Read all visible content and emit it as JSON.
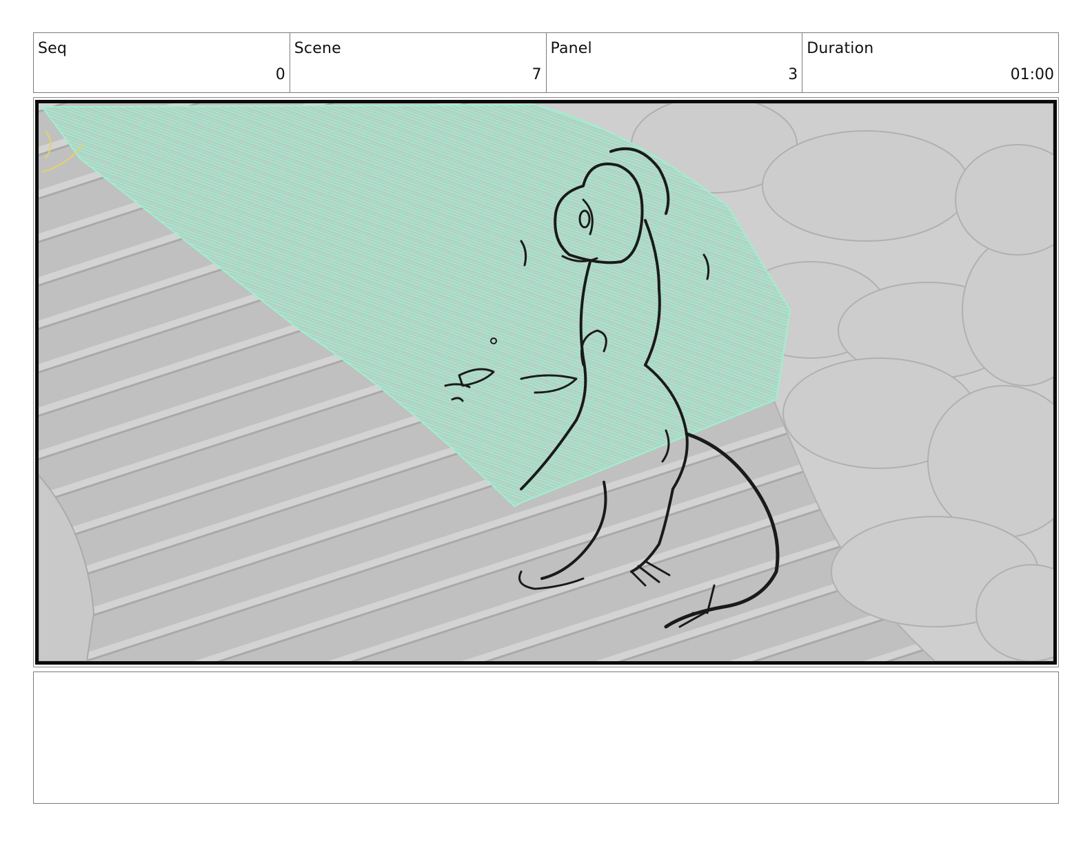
{
  "header": {
    "seq": {
      "label": "Seq",
      "value": "0"
    },
    "scene": {
      "label": "Scene",
      "value": "7"
    },
    "panel": {
      "label": "Panel",
      "value": "3"
    },
    "duration": {
      "label": "Duration",
      "value": "01:00"
    }
  },
  "colors": {
    "grid": "#9ff0cf",
    "ground": "#c2c2c2",
    "rocks": "#cfcfcf",
    "ink": "#1a1a1a",
    "frame": "#0b0b0b"
  },
  "notes": {
    "text": ""
  }
}
